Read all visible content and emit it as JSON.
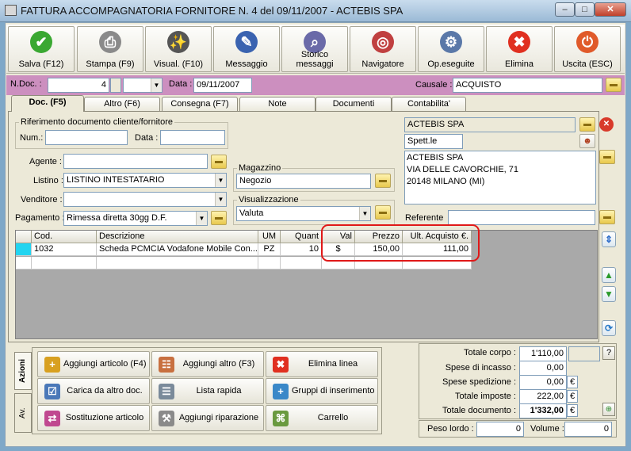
{
  "window": {
    "title": "FATTURA ACCOMPAGNATORIA FORNITORE N. 4  del 09/11/2007 - ACTEBIS SPA",
    "min": "–",
    "max": "□",
    "close": "✕"
  },
  "toolbar": [
    {
      "label": "Salva (F12)",
      "icon": "check-icon",
      "glyph": "✔",
      "color": "#3aa832"
    },
    {
      "label": "Stampa (F9)",
      "icon": "printer-icon",
      "glyph": "⎙",
      "color": "#8a8a8a"
    },
    {
      "label": "Visual. (F10)",
      "icon": "magic-wand-icon",
      "glyph": "✨",
      "color": "#555555"
    },
    {
      "label": "Messaggio",
      "icon": "pen-document-icon",
      "glyph": "✎",
      "color": "#3a63b0"
    },
    {
      "label": "Storico messaggi",
      "icon": "history-search-icon",
      "glyph": "⌕",
      "color": "#6a6aa8"
    },
    {
      "label": "Navigatore",
      "icon": "compass-icon",
      "glyph": "◎",
      "color": "#c04040"
    },
    {
      "label": "Op.eseguite",
      "icon": "gears-icon",
      "glyph": "⚙",
      "color": "#5a78a8"
    },
    {
      "label": "Elimina",
      "icon": "delete-x-icon",
      "glyph": "✖",
      "color": "#e03020"
    },
    {
      "label": "Uscita (ESC)",
      "icon": "exit-icon",
      "glyph": "⏻",
      "color": "#e05a2a"
    }
  ],
  "header": {
    "ndoc_label": "N.Doc. :",
    "ndoc_value": "4",
    "data_label": "Data :",
    "data_value": "09/11/2007",
    "causale_label": "Causale :",
    "causale_value": "ACQUISTO"
  },
  "tabs": [
    "Doc. (F5)",
    "Altro (F6)",
    "Consegna (F7)",
    "Note",
    "Documenti",
    "Contabilita'"
  ],
  "doc": {
    "rif_legend": "Riferimento documento cliente/fornitore",
    "num_label": "Num.:",
    "num_value": "",
    "data_label": "Data :",
    "data_value": "",
    "agente_label": "Agente :",
    "agente_value": "",
    "listino_label": "Listino :",
    "listino_value": "LISTINO INTESTATARIO",
    "venditore_label": "Venditore :",
    "venditore_value": "",
    "pagamento_label": "Pagamento :",
    "pagamento_value": "Rimessa diretta 30gg D.F.",
    "magazzino_legend": "Magazzino",
    "magazzino_value": "Negozio",
    "visual_legend": "Visualizzazione",
    "visual_value": "Valuta",
    "supplier_name": "ACTEBIS SPA",
    "salutation": "Spett.le",
    "address_lines": [
      "ACTEBIS SPA",
      "VIA DELLE CAVORCHIE, 71",
      "20148 MILANO (MI)"
    ],
    "referente_label": "Referente",
    "referente_value": ""
  },
  "grid": {
    "columns": [
      "Cod.",
      "Descrizione",
      "UM",
      "Quant",
      "Val",
      "Prezzo",
      "Ult. Acquisto €."
    ],
    "rows": [
      {
        "cod": "1032",
        "descrizione": "Scheda PCMCIA Vodafone Mobile Con...",
        "um": "PZ",
        "quant": "10",
        "val": "$",
        "prezzo": "150,00",
        "ult": "111,00"
      }
    ]
  },
  "side_tabs": [
    "Azioni",
    "Av."
  ],
  "actions": [
    {
      "label": "Aggiungi articolo (F4)",
      "icon": "add-box-icon",
      "glyph": "+",
      "color": "#d8a020"
    },
    {
      "label": "Aggiungi altro (F3)",
      "icon": "add-table-icon",
      "glyph": "☷",
      "color": "#c87040"
    },
    {
      "label": "Elimina linea",
      "icon": "delete-line-icon",
      "glyph": "✖",
      "color": "#e03020"
    },
    {
      "label": "Carica da altro doc.",
      "icon": "load-doc-icon",
      "glyph": "☑",
      "color": "#4a78b8"
    },
    {
      "label": "Lista rapida",
      "icon": "quick-list-icon",
      "glyph": "☰",
      "color": "#7a8a9a"
    },
    {
      "label": "Gruppi di inserimento",
      "icon": "groups-icon",
      "glyph": "+",
      "color": "#3a88c8"
    },
    {
      "label": "Sostituzione articolo",
      "icon": "swap-icon",
      "glyph": "⇄",
      "color": "#c04890"
    },
    {
      "label": "Aggiungi riparazione",
      "icon": "wrench-icon",
      "glyph": "⚒",
      "color": "#8a8a8a"
    },
    {
      "label": "Carrello",
      "icon": "cart-icon",
      "glyph": "⌘",
      "color": "#6a9a40"
    }
  ],
  "totals": {
    "corpo_label": "Totale corpo :",
    "corpo_value": "1'110,00",
    "incasso_label": "Spese di incasso :",
    "incasso_value": "0,00",
    "spedizione_label": "Spese spedizione :",
    "spedizione_value": "0,00",
    "imposte_label": "Totale imposte :",
    "imposte_value": "222,00",
    "documento_label": "Totale documento :",
    "documento_value": "1'332,00",
    "currency": "€",
    "help": "?"
  },
  "weights": {
    "lordo_label": "Peso lordo :",
    "lordo_value": "0",
    "volume_label": "Volume :",
    "volume_value": "0"
  },
  "colors": {
    "pink_bar": "#cc8fbf",
    "highlight_box": "#e01818",
    "grid_bg": "#a9a9a9"
  }
}
